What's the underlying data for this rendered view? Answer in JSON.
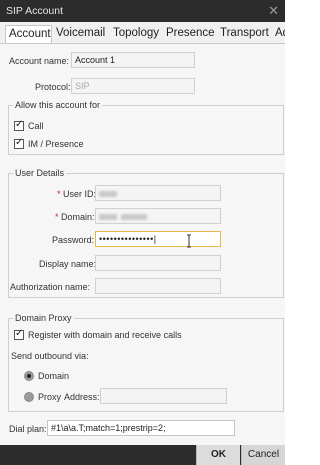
{
  "window": {
    "title": "SIP Account",
    "close_glyph": "✕"
  },
  "tabs": [
    {
      "label": "Account",
      "active": true
    },
    {
      "label": "Voicemail",
      "active": false
    },
    {
      "label": "Topology",
      "active": false
    },
    {
      "label": "Presence",
      "active": false
    },
    {
      "label": "Transport",
      "active": false
    },
    {
      "label": "Advanced",
      "active": false
    }
  ],
  "account": {
    "name_label": "Account name:",
    "name_value": "Account 1",
    "protocol_label": "Protocol:",
    "protocol_value": "SIP"
  },
  "allow": {
    "legend": "Allow this account for",
    "call_label": "Call",
    "call_checked": true,
    "im_label": "IM / Presence",
    "im_checked": true
  },
  "user_details": {
    "legend": "User Details",
    "required_mark": "*",
    "user_id_label": "User ID:",
    "domain_label": "Domain:",
    "password_label": "Password:",
    "password_value": "•••••••••••••••|",
    "display_name_label": "Display name:",
    "display_name_value": "",
    "auth_name_label": "Authorization name:",
    "auth_name_value": ""
  },
  "domain_proxy": {
    "legend": "Domain Proxy",
    "register_label": "Register with domain and receive calls",
    "register_checked": true,
    "send_via_label": "Send outbound via:",
    "domain_option_label": "Domain",
    "domain_selected": true,
    "proxy_option_label": "Proxy",
    "address_label": "Address:",
    "address_value": ""
  },
  "dial_plan": {
    "label": "Dial plan:",
    "value": "#1\\a\\a.T;match=1;prestrip=2;"
  },
  "footer": {
    "ok_label": "OK",
    "cancel_label": "Cancel"
  },
  "colors": {
    "titlebar": "#2c2c2c",
    "focus_border": "#e6b84a",
    "required": "#cc2222"
  },
  "icons": {
    "cursor": "text-cursor-icon",
    "close": "close-icon"
  }
}
